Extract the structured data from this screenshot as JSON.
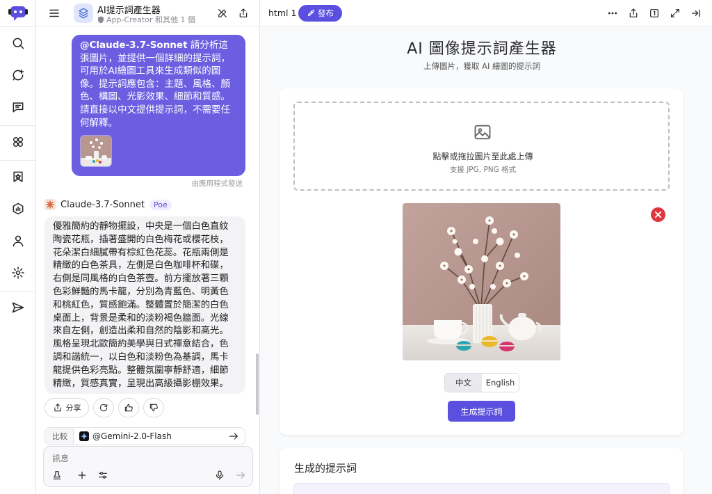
{
  "chat": {
    "bot_title": "AI提示詞產生器",
    "bot_subtitle": "App-Creator 和其他 1 個",
    "user_message": {
      "mention": "@Claude-3.7-Sonnet",
      "text": " 請分析這張圖片，並提供一個詳細的提示詞，可用於AI繪圖工具來生成類似的圖像。提示詞應包含：主題、風格、顏色、構圖、光影效果、細節和質感。請直接以中文提供提示詞，不需要任何解釋。"
    },
    "sent_via": "由應用程式發送",
    "bot_name": "Claude-3.7-Sonnet",
    "bot_badge": "Poe",
    "bot_reply": "優雅簡約的靜物擺設，中央是一個白色直紋陶瓷花瓶，插著盛開的白色梅花或櫻花枝，花朵潔白細膩帶有棕紅色花蕊。花瓶兩側是精緻的白色茶具，左側是白色咖啡杯和碟，右側是同風格的白色茶壺。前方擺放著三顆色彩鮮豔的馬卡龍，分別為青藍色、明黃色和桃紅色，質感飽滿。整體置於簡潔的白色桌面上，背景是柔和的淡粉褐色牆面。光線來自左側，創造出柔和自然的陰影和高光。風格呈現北歐簡約美學與日式禪意結合，色調和諧統一，以白色和淡粉色為基調，馬卡龍提供色彩亮點。整體氛圍寧靜舒適，細節精緻，質感真實，呈現出高級攝影棚效果。",
    "share_label": "分享",
    "compare_label": "比較",
    "compare_bot": "@Gemini-2.0-Flash",
    "composer_placeholder": "訊息"
  },
  "preview": {
    "file_name": "html 1",
    "publish_label": "發布",
    "app_title": "AI 圖像提示詞產生器",
    "app_subtitle": "上傳圖片，獲取 AI 繪圖的提示詞",
    "dropzone_main": "點擊或拖拉圖片至此處上傳",
    "dropzone_sub": "支援 JPG, PNG 格式",
    "lang_options": [
      "中文",
      "English"
    ],
    "lang_selected": "中文",
    "generate_label": "生成提示詞",
    "result_title": "生成的提示詞"
  },
  "colors": {
    "accent": "#5b4fe0",
    "user_bubble": "#6b5ee0",
    "danger": "#e0363f",
    "image_bg": "#b89790"
  }
}
